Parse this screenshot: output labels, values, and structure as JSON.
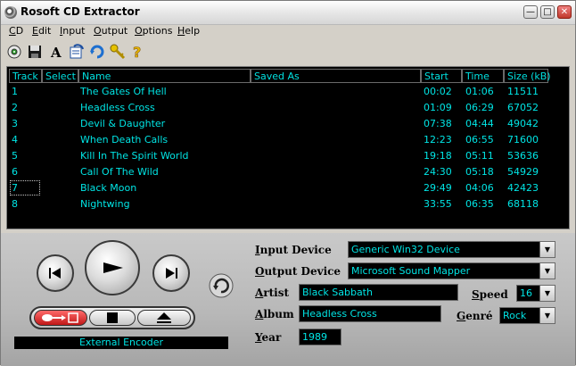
{
  "window": {
    "title": "Rosoft CD Extractor"
  },
  "menu": [
    {
      "key": "C",
      "rest": "D"
    },
    {
      "key": "E",
      "rest": "dit"
    },
    {
      "key": "I",
      "rest": "nput"
    },
    {
      "key": "O",
      "rest": "utput"
    },
    {
      "key": "O",
      "rest": "ptions"
    },
    {
      "key": "H",
      "rest": "elp"
    }
  ],
  "toolbar_icons": [
    "cd-drive-icon",
    "save-icon",
    "font-icon",
    "refresh-list-icon",
    "rotate-icon",
    "key-icon",
    "help-icon"
  ],
  "columns": [
    "Track",
    "Select",
    "Name",
    "Saved As",
    "Start",
    "Time",
    "Size (kB)"
  ],
  "tracks": [
    {
      "track": "1",
      "select": "",
      "name": "The Gates Of Hell",
      "saved_as": "",
      "start": "00:02",
      "time": "01:06",
      "size": "11511"
    },
    {
      "track": "2",
      "select": "",
      "name": "Headless Cross",
      "saved_as": "",
      "start": "01:09",
      "time": "06:29",
      "size": "67052"
    },
    {
      "track": "3",
      "select": "",
      "name": "Devil & Daughter",
      "saved_as": "",
      "start": "07:38",
      "time": "04:44",
      "size": "49042"
    },
    {
      "track": "4",
      "select": "",
      "name": "When Death Calls",
      "saved_as": "",
      "start": "12:23",
      "time": "06:55",
      "size": "71600"
    },
    {
      "track": "5",
      "select": "",
      "name": "Kill In The Spirit World",
      "saved_as": "",
      "start": "19:18",
      "time": "05:11",
      "size": "53636"
    },
    {
      "track": "6",
      "select": "",
      "name": "Call Of The Wild",
      "saved_as": "",
      "start": "24:30",
      "time": "05:18",
      "size": "54929"
    },
    {
      "track": "7",
      "select": "",
      "name": "Black Moon",
      "saved_as": "",
      "start": "29:49",
      "time": "04:06",
      "size": "42423"
    },
    {
      "track": "8",
      "select": "",
      "name": "Nightwing",
      "saved_as": "",
      "start": "33:55",
      "time": "06:35",
      "size": "68118"
    }
  ],
  "status": "External Encoder",
  "labels": {
    "input_device": {
      "key": "I",
      "rest": "nput Device"
    },
    "output_device": {
      "key": "O",
      "rest": "utput Device"
    },
    "artist": {
      "key": "A",
      "rest": "rtist"
    },
    "album": {
      "key": "A",
      "rest": "lbum"
    },
    "year": {
      "key": "Y",
      "rest": "ear"
    },
    "speed": {
      "key": "S",
      "rest": "peed"
    },
    "genre": {
      "key": "G",
      "rest": "enré"
    }
  },
  "values": {
    "input_device": "Generic Win32 Device",
    "output_device": "Microsoft Sound Mapper",
    "artist": "Black Sabbath",
    "album": "Headless Cross",
    "year": "1989",
    "speed": "16",
    "genre": "Rock"
  },
  "colors": {
    "list_bg": "#000000",
    "list_text": "#00e5e5",
    "panel": "#c0c0c0"
  }
}
